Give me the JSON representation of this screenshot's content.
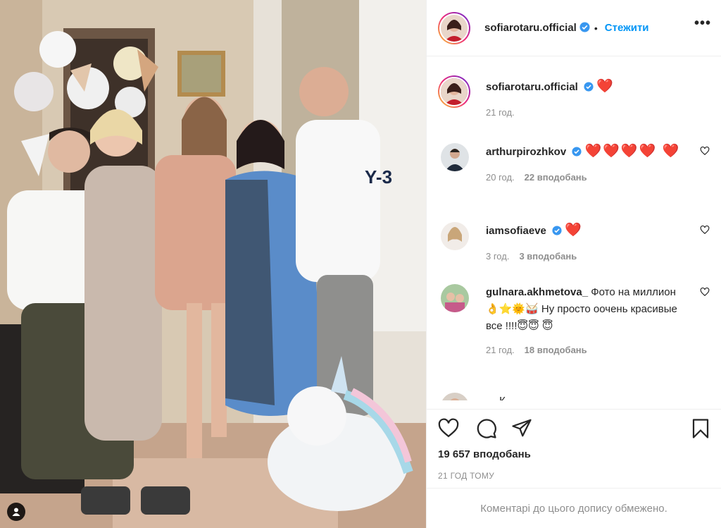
{
  "header": {
    "username": "sofiarotaru.official",
    "follow_label": "Стежити",
    "more_label": "•••"
  },
  "caption": {
    "username": "sofiarotaru.official",
    "text": "❤️",
    "time": "21 год."
  },
  "comments": [
    {
      "username": "arthurpirozhkov",
      "text": "❤️❤️❤️❤️ ❤️",
      "time": "20 год.",
      "likes": "22 вподобань"
    },
    {
      "username": "iamsofiaeve",
      "text": "❤️",
      "time": "3 год.",
      "likes": "3 вподобань"
    },
    {
      "username": "gulnara.akhmetova_",
      "text": "Фото на миллион 👌⭐🌞🥁 Ну просто оочень красивые все !!!!😇😇 😇",
      "time": "21 год.",
      "likes": "18 вподобань"
    },
    {
      "username": "…",
      "text": "К…"
    }
  ],
  "post": {
    "likes": "19 657 вподобань",
    "time_ago": "21 ГОД ТОМУ",
    "comments_disabled": "Коментарі до цього допису обмежено."
  },
  "icons": [
    "heart-icon",
    "comment-icon",
    "share-icon",
    "bookmark-icon",
    "verified-icon",
    "more-icon",
    "tag-icon"
  ],
  "colors": {
    "accent": "#0095f6",
    "heart": "#e0142b",
    "muted": "#8e8e8e",
    "text": "#262626"
  }
}
